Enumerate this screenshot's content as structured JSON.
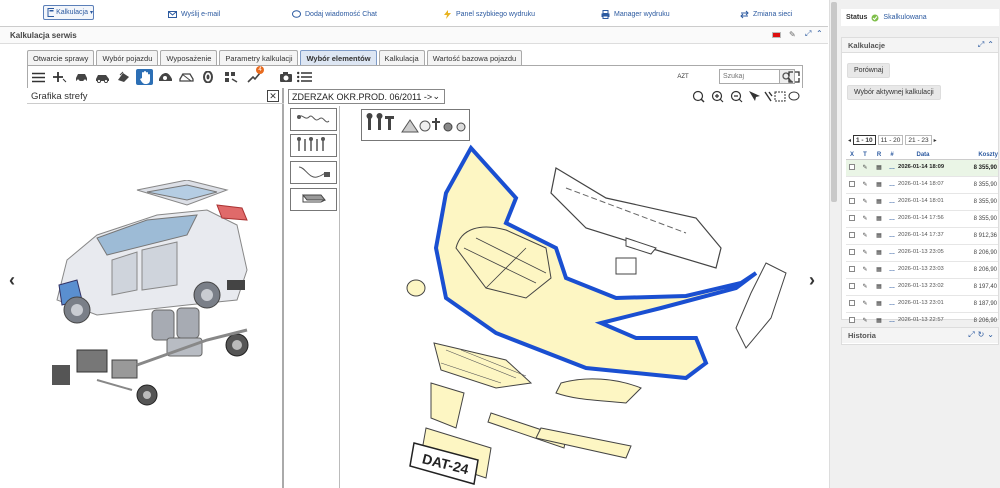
{
  "topbar": {
    "kalkulacja_select": "Kalkulacja",
    "send_email": "Wyślij e-mail",
    "add_chat": "Dodaj wiadomość Chat",
    "quick_print": "Panel szybkiego wydruku",
    "print_manager": "Manager wydruku",
    "network_change": "Zmiana sieci"
  },
  "section": {
    "title": "Kalkulacja serwis"
  },
  "tabs": [
    {
      "label": "Otwarcie sprawy"
    },
    {
      "label": "Wybór pojazdu"
    },
    {
      "label": "Wyposażenie"
    },
    {
      "label": "Parametry kalkulacji"
    },
    {
      "label": "Wybór elementów"
    },
    {
      "label": "Kalkulacja"
    },
    {
      "label": "Wartość bazowa pojazdu"
    }
  ],
  "toolbar": {
    "search_placeholder": "Szukaj",
    "notification_count": "4",
    "azt_label": "AZT"
  },
  "left_panel": {
    "title": "Grafika strefy",
    "close": "✕"
  },
  "right_panel": {
    "part_group": "ZDERZAK OKR.PROD. 06/2011 ->",
    "plate_text": "DAT-24"
  },
  "sidebar": {
    "status_label": "Status",
    "status_value": "Skalkulowana",
    "calc_title": "Kalkulacje",
    "compare_btn": "Porównaj",
    "choose_active_btn": "Wybór aktywnej kalkulacji",
    "pages": [
      "1 - 10",
      "11 - 20",
      "21 - 23"
    ],
    "columns": [
      "X",
      "T",
      "R",
      "#",
      "Data",
      "Koszty"
    ],
    "rows": [
      {
        "date": "2026-01-14 18:09",
        "cost": "8 355,90",
        "highlight": true
      },
      {
        "date": "2026-01-14 18:07",
        "cost": "8 355,90"
      },
      {
        "date": "2026-01-14 18:01",
        "cost": "8 355,90"
      },
      {
        "date": "2026-01-14 17:56",
        "cost": "8 355,90"
      },
      {
        "date": "2026-01-14 17:37",
        "cost": "8 912,36"
      },
      {
        "date": "2026-01-13 23:05",
        "cost": "8 206,90"
      },
      {
        "date": "2026-01-13 23:03",
        "cost": "8 206,90"
      },
      {
        "date": "2026-01-13 23:02",
        "cost": "8 197,40"
      },
      {
        "date": "2026-01-13 23:01",
        "cost": "8 187,90"
      },
      {
        "date": "2026-01-13 22:57",
        "cost": "8 206,90"
      }
    ],
    "history_title": "Historia"
  },
  "colors": {
    "accent": "#2c5aa0",
    "active_tab": "#dde6f3",
    "highlight_part": "#fdf6c3",
    "selection_outline": "#1a4fd1"
  }
}
